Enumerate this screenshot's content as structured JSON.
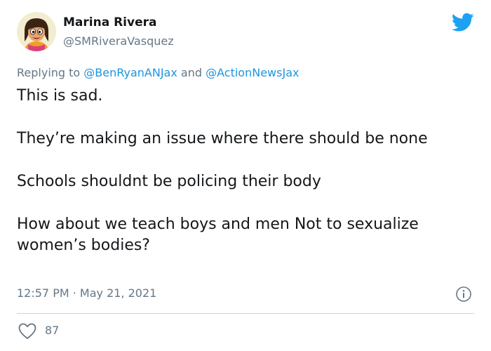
{
  "author": {
    "display_name": "Marina Rivera",
    "handle": "@SMRiveraVasquez"
  },
  "reply": {
    "prefix": "Replying to",
    "mention_1": "@BenRyanANJax",
    "conjunction": "and",
    "mention_2": "@ActionNewsJax"
  },
  "tweet": {
    "paragraphs": [
      "This is sad.",
      "They’re making an issue where there should be none",
      "Schools shouldnt be policing their body",
      "How about we teach boys and men Not to sexualize women’s bodies?"
    ],
    "timestamp": "12:57 PM · May 21, 2021"
  },
  "engagement": {
    "likes": "87"
  },
  "icons": {
    "brand": "twitter-bird-icon",
    "info": "info-icon",
    "like": "heart-icon"
  },
  "colors": {
    "brand": "#1da1f2",
    "mention": "#1b95e0",
    "secondary_text": "#657786",
    "divider": "#ccd6dd"
  }
}
